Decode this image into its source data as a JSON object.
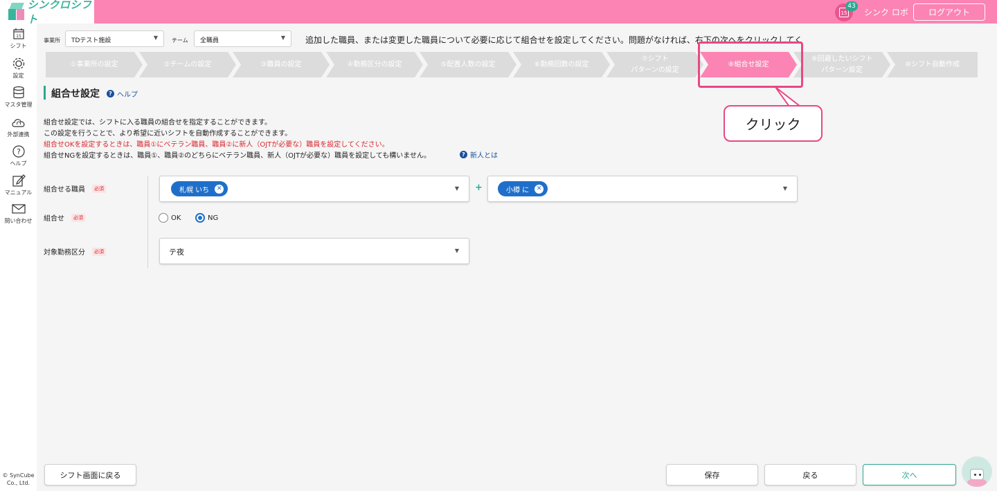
{
  "header": {
    "app_name": "シンクロシフト",
    "calendar_day": "15",
    "notification_count": "43",
    "user_name": "シンク ロボ",
    "logout_label": "ログアウト"
  },
  "sidebar": {
    "items": [
      {
        "label": "シフト",
        "icon": "calendar-icon"
      },
      {
        "label": "設定",
        "icon": "gear-icon"
      },
      {
        "label": "マスタ管理",
        "icon": "database-icon"
      },
      {
        "label": "外部連携",
        "icon": "cloud-sync-icon"
      },
      {
        "label": "ヘルプ",
        "icon": "question-icon"
      },
      {
        "label": "マニュアル",
        "icon": "edit-icon"
      },
      {
        "label": "問い合わせ",
        "icon": "mail-icon"
      }
    ],
    "calendar_day": "15",
    "copyright_line1": "© SynCube",
    "copyright_line2": "Co., Ltd."
  },
  "filters": {
    "office_label": "事業所",
    "office_value": "TDテスト施設",
    "team_label": "チーム",
    "team_value": "全職員"
  },
  "info_text": "追加した職員、または変更した職員について必要に応じて組合せを設定してください。問題がなければ、右下の次へをクリックしてください。",
  "steps": [
    {
      "line1": "①事業所の設定",
      "line2": ""
    },
    {
      "line1": "②チームの設定",
      "line2": ""
    },
    {
      "line1": "③職員の設定",
      "line2": ""
    },
    {
      "line1": "④勤務区分の設定",
      "line2": ""
    },
    {
      "line1": "⑤配置人数の設定",
      "line2": ""
    },
    {
      "line1": "⑥勤務回数の設定",
      "line2": ""
    },
    {
      "line1": "⑦シフト",
      "line2": "パターンの設定"
    },
    {
      "line1": "⑧組合せ設定",
      "line2": ""
    },
    {
      "line1": "⑨回避したいシフト",
      "line2": "パターン設定"
    },
    {
      "line1": "⑩シフト自動作成",
      "line2": ""
    }
  ],
  "callout": "クリック",
  "section": {
    "title": "組合せ設定",
    "help": "ヘルプ"
  },
  "description": {
    "line1": "組合せ設定では、シフトに入る職員の組合せを指定することができます。",
    "line2": "この設定を行うことで、より希望に近いシフトを自動作成することができます。",
    "line3": "組合せOKを設定するときは、職員①にベテラン職員、職員②に新人（OJTが必要な）職員を設定してください。",
    "line4": "組合せNGを設定するときは、職員①、職員②のどちらにベテラン職員、新人（OJTが必要な）職員を設定しても構いません。",
    "newbie_link": "新人とは"
  },
  "form": {
    "required": "必須",
    "staff_label": "組合せる職員",
    "staff1": "札幌 いち",
    "staff2": "小樽 に",
    "plus": "+",
    "combo_label": "組合せ",
    "ok_label": "OK",
    "ng_label": "NG",
    "selected": "NG",
    "shift_label": "対象勤務区分",
    "shift_value": "テ夜"
  },
  "buttons": {
    "back_to_shift": "シフト画面に戻る",
    "save": "保存",
    "back": "戻る",
    "next": "次へ"
  },
  "colors": {
    "brand_pink": "#fc84b4",
    "accent_green": "#2ba891",
    "chip_blue": "#1f6fca",
    "highlight": "#e94785"
  }
}
